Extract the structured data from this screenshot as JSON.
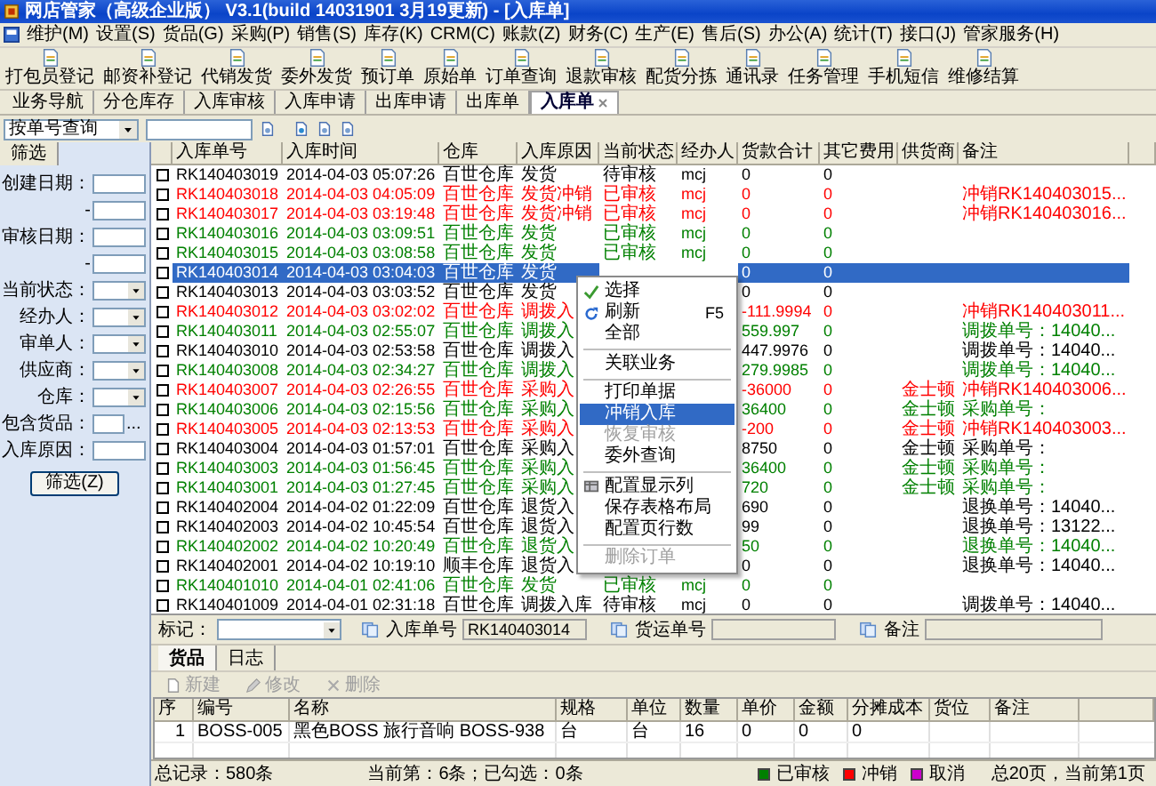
{
  "window": {
    "title": "网店管家（高级企业版） V3.1(build 14031901 3月19更新) - [入库单]"
  },
  "menu": [
    "维护(M)",
    "设置(S)",
    "货品(G)",
    "采购(P)",
    "销售(S)",
    "库存(K)",
    "CRM(C)",
    "账款(Z)",
    "财务(C)",
    "生产(E)",
    "售后(S)",
    "办公(A)",
    "统计(T)",
    "接口(J)",
    "管家服务(H)"
  ],
  "toolbar": [
    "打包员登记",
    "邮资补登记",
    "代销发货",
    "委外发货",
    "预订单",
    "原始单",
    "订单查询",
    "退款审核",
    "配货分拣",
    "通讯录",
    "任务管理",
    "手机短信",
    "维修结算"
  ],
  "doc_tabs": [
    {
      "label": "业务导航",
      "selected": false,
      "closable": false
    },
    {
      "label": "分仓库存",
      "selected": false,
      "closable": false
    },
    {
      "label": "入库审核",
      "selected": false,
      "closable": false
    },
    {
      "label": "入库申请",
      "selected": false,
      "closable": false
    },
    {
      "label": "出库申请",
      "selected": false,
      "closable": false
    },
    {
      "label": "出库单",
      "selected": false,
      "closable": false
    },
    {
      "label": "入库单",
      "selected": true,
      "closable": true
    }
  ],
  "query": {
    "mode": "按单号查询"
  },
  "filter": {
    "tab": "筛选",
    "fields": [
      {
        "label": "创建日期：",
        "kind": "text"
      },
      {
        "label": "-",
        "kind": "text"
      },
      {
        "label": "审核日期：",
        "kind": "text"
      },
      {
        "label": "-",
        "kind": "text"
      },
      {
        "label": "当前状态：",
        "kind": "select"
      },
      {
        "label": "经办人：",
        "kind": "select"
      },
      {
        "label": "审单人：",
        "kind": "select"
      },
      {
        "label": "供应商：",
        "kind": "select"
      },
      {
        "label": "仓库：",
        "kind": "select"
      },
      {
        "label": "包含货品：",
        "kind": "picker",
        "button": "..."
      },
      {
        "label": "入库原因：",
        "kind": "text"
      }
    ],
    "button": "筛选(Z)"
  },
  "orders": {
    "columns": [
      "入库单号",
      "入库时间",
      "仓库",
      "入库原因",
      "当前状态",
      "经办人",
      "货款合计",
      "其它费用",
      "供货商",
      "备注"
    ],
    "rows": [
      {
        "no": "RK140403019",
        "time": "2014-04-03 05:07:26",
        "warehouse": "百世仓库",
        "reason": "发货",
        "status": "待审核",
        "handler": "mcj",
        "amount": "0",
        "other": "0",
        "color": "#000000",
        "selected": false,
        "checked": false
      },
      {
        "no": "RK140403018",
        "time": "2014-04-03 04:05:09",
        "warehouse": "百世仓库",
        "reason": "发货冲销",
        "status": "已审核",
        "handler": "mcj",
        "amount": "0",
        "other": "0",
        "note": "冲销RK140403015...",
        "color": "#ff0000",
        "selected": false,
        "checked": false
      },
      {
        "no": "RK140403017",
        "time": "2014-04-03 03:19:48",
        "warehouse": "百世仓库",
        "reason": "发货冲销",
        "status": "已审核",
        "handler": "mcj",
        "amount": "0",
        "other": "0",
        "note": "冲销RK140403016...",
        "color": "#ff0000",
        "selected": false,
        "checked": false
      },
      {
        "no": "RK140403016",
        "time": "2014-04-03 03:09:51",
        "warehouse": "百世仓库",
        "reason": "发货",
        "status": "已审核",
        "handler": "mcj",
        "amount": "0",
        "other": "0",
        "color": "#008000",
        "selected": false,
        "checked": false
      },
      {
        "no": "RK140403015",
        "time": "2014-04-03 03:08:58",
        "warehouse": "百世仓库",
        "reason": "发货",
        "status": "已审核",
        "handler": "mcj",
        "amount": "0",
        "other": "0",
        "color": "#008000",
        "selected": false,
        "checked": false
      },
      {
        "no": "RK140403014",
        "time": "2014-04-03 03:04:03",
        "warehouse": "百世仓库",
        "reason": "发货",
        "amount": "0",
        "other": "0",
        "selected": true,
        "checked": false
      },
      {
        "no": "RK140403013",
        "time": "2014-04-03 03:03:52",
        "warehouse": "百世仓库",
        "reason": "发货",
        "amount": "0",
        "other": "0",
        "color": "#000000",
        "selected": false,
        "checked": false
      },
      {
        "no": "RK140403012",
        "time": "2014-04-03 03:02:02",
        "warehouse": "百世仓库",
        "reason": "调拨入",
        "amount": "-111.9994",
        "other": "0",
        "note": "冲销RK140403011...",
        "color": "#ff0000",
        "selected": false,
        "checked": false
      },
      {
        "no": "RK140403011",
        "time": "2014-04-03 02:55:07",
        "warehouse": "百世仓库",
        "reason": "调拨入",
        "amount": "559.997",
        "other": "0",
        "note": "调拨单号：14040...",
        "color": "#008000",
        "selected": false,
        "checked": false
      },
      {
        "no": "RK140403010",
        "time": "2014-04-03 02:53:58",
        "warehouse": "百世仓库",
        "reason": "调拨入",
        "amount": "447.9976",
        "other": "0",
        "note": "调拨单号：14040...",
        "color": "#000000",
        "selected": false,
        "checked": false
      },
      {
        "no": "RK140403008",
        "time": "2014-04-03 02:34:27",
        "warehouse": "百世仓库",
        "reason": "调拨入",
        "amount": "279.9985",
        "other": "0",
        "note": "调拨单号：14040...",
        "color": "#008000",
        "selected": false,
        "checked": false
      },
      {
        "no": "RK140403007",
        "time": "2014-04-03 02:26:55",
        "warehouse": "百世仓库",
        "reason": "采购入",
        "amount": "-36000",
        "other": "0",
        "supplier": "金士顿",
        "note": "冲销RK140403006...",
        "color": "#ff0000",
        "selected": false,
        "checked": false
      },
      {
        "no": "RK140403006",
        "time": "2014-04-03 02:15:56",
        "warehouse": "百世仓库",
        "reason": "采购入",
        "amount": "36400",
        "other": "0",
        "supplier": "金士顿",
        "note": "采购单号：",
        "color": "#008000",
        "selected": false,
        "checked": false
      },
      {
        "no": "RK140403005",
        "time": "2014-04-03 02:13:53",
        "warehouse": "百世仓库",
        "reason": "采购入",
        "amount": "-200",
        "other": "0",
        "supplier": "金士顿",
        "note": "冲销RK140403003...",
        "color": "#ff0000",
        "selected": false,
        "checked": false
      },
      {
        "no": "RK140403004",
        "time": "2014-04-03 01:57:01",
        "warehouse": "百世仓库",
        "reason": "采购入",
        "amount": "8750",
        "other": "0",
        "supplier": "金士顿",
        "note": "采购单号：",
        "color": "#000000",
        "selected": false,
        "checked": false
      },
      {
        "no": "RK140403003",
        "time": "2014-04-03 01:56:45",
        "warehouse": "百世仓库",
        "reason": "采购入",
        "amount": "36400",
        "other": "0",
        "supplier": "金士顿",
        "note": "采购单号：",
        "color": "#008000",
        "selected": false,
        "checked": false
      },
      {
        "no": "RK140403001",
        "time": "2014-04-03 01:27:45",
        "warehouse": "百世仓库",
        "reason": "采购入",
        "amount": "720",
        "other": "0",
        "supplier": "金士顿",
        "note": "采购单号：",
        "color": "#008000",
        "selected": false,
        "checked": false
      },
      {
        "no": "RK140402004",
        "time": "2014-04-02 01:22:09",
        "warehouse": "百世仓库",
        "reason": "退货入",
        "amount": "690",
        "other": "0",
        "note": "退换单号：14040...",
        "color": "#000000",
        "selected": false,
        "checked": false
      },
      {
        "no": "RK140402003",
        "time": "2014-04-02 10:45:54",
        "warehouse": "百世仓库",
        "reason": "退货入",
        "amount": "99",
        "other": "0",
        "note": "退换单号：13122...",
        "color": "#000000",
        "selected": false,
        "checked": false
      },
      {
        "no": "RK140402002",
        "time": "2014-04-02 10:20:49",
        "warehouse": "百世仓库",
        "reason": "退货入",
        "amount": "50",
        "other": "0",
        "note": "退换单号：14040...",
        "color": "#008000",
        "selected": false,
        "checked": false
      },
      {
        "no": "RK140402001",
        "time": "2014-04-02 10:19:10",
        "warehouse": "顺丰仓库",
        "reason": "退货入",
        "amount": "0",
        "other": "0",
        "note": "退换单号：14040...",
        "color": "#000000",
        "selected": false,
        "checked": false
      },
      {
        "no": "RK140401010",
        "time": "2014-04-01 02:41:06",
        "warehouse": "百世仓库",
        "reason": "发货",
        "status": "已审核",
        "handler": "mcj",
        "amount": "0",
        "other": "0",
        "color": "#008000",
        "selected": false,
        "checked": false
      },
      {
        "no": "RK140401009",
        "time": "2014-04-01 02:31:18",
        "warehouse": "百世仓库",
        "reason": "调拨入库",
        "status": "待审核",
        "handler": "mcj",
        "amount": "0",
        "other": "0",
        "note": "调拨单号：14040...",
        "color": "#000000",
        "selected": false,
        "checked": false
      }
    ]
  },
  "context_menu": {
    "groups": [
      [
        {
          "label": "选择",
          "kind": "check",
          "selected": false,
          "disabled": false
        },
        {
          "label": "刷新",
          "kind": "refresh",
          "shortcut": "F5",
          "selected": false,
          "disabled": false
        },
        {
          "label": "全部",
          "kind": "plain",
          "selected": false,
          "disabled": false
        }
      ],
      [
        {
          "label": "关联业务",
          "kind": "plain",
          "selected": false,
          "disabled": false
        }
      ],
      [
        {
          "label": "打印单据",
          "kind": "plain",
          "selected": false,
          "disabled": false
        },
        {
          "label": "冲销入库",
          "kind": "plain",
          "selected": true,
          "disabled": false
        },
        {
          "label": "恢复审核",
          "kind": "plain",
          "selected": false,
          "disabled": true
        },
        {
          "label": "委外查询",
          "kind": "plain",
          "selected": false,
          "disabled": false
        }
      ],
      [
        {
          "label": "配置显示列",
          "kind": "grid",
          "selected": false,
          "disabled": false
        },
        {
          "label": "保存表格布局",
          "kind": "plain",
          "selected": false,
          "disabled": false
        },
        {
          "label": "配置页行数",
          "kind": "plain",
          "selected": false,
          "disabled": false
        }
      ],
      [
        {
          "label": "删除订单",
          "kind": "plain",
          "selected": false,
          "disabled": true
        }
      ]
    ]
  },
  "mark_bar": {
    "mark_label": "标记：",
    "order_label": "入库单号",
    "order_value": "RK140403014",
    "waybill_label": "货运单号",
    "note_label": "备注"
  },
  "detail": {
    "tabs": [
      {
        "label": "货品",
        "selected": true
      },
      {
        "label": "日志",
        "selected": false
      }
    ],
    "actions": [
      {
        "label": "新建",
        "kind": "new",
        "disabled": true
      },
      {
        "label": "修改",
        "kind": "edit",
        "disabled": true
      },
      {
        "label": "删除",
        "kind": "delete",
        "disabled": true
      }
    ],
    "columns": [
      "序",
      "编号",
      "名称",
      "规格",
      "单位",
      "数量",
      "单价",
      "金额",
      "分摊成本",
      "货位",
      "备注"
    ],
    "rows": [
      {
        "cells": [
          "1",
          "BOSS-005",
          "黑色BOSS 旅行音响 BOSS-938",
          "台",
          "台",
          "16",
          "0",
          "0",
          "0"
        ]
      }
    ]
  },
  "status_bar": {
    "total": "总记录：580条",
    "current": "当前第：6条；已勾选：0条",
    "legend": [
      {
        "label": "已审核",
        "color": "#008000"
      },
      {
        "label": "冲销",
        "color": "#ff0000"
      },
      {
        "label": "取消",
        "color": "#cc00cc"
      }
    ],
    "pages": "总20页，当前第1页"
  }
}
